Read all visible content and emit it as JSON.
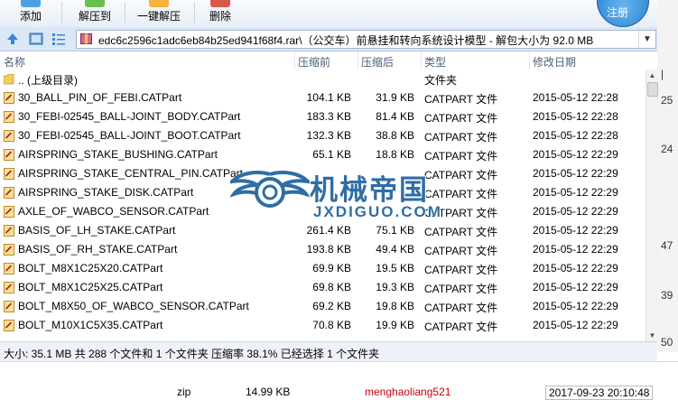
{
  "toolbar": {
    "buttons": [
      {
        "label": "添加",
        "icon": "add-icon"
      },
      {
        "label": "解压到",
        "icon": "extract-to-icon"
      },
      {
        "label": "一键解压",
        "icon": "one-click-extract-icon"
      },
      {
        "label": "删除",
        "icon": "delete-icon"
      }
    ],
    "logo_text": "注册"
  },
  "address": {
    "path": "edc6c2596c1adc6eb84b25ed941f68f4.rar\\（公交车）前悬挂和转向系统设计模型 - 解包大小为 92.0 MB"
  },
  "columns": {
    "name": "名称",
    "size": "压缩前",
    "packed": "压缩后",
    "type": "类型",
    "modified": "修改日期"
  },
  "files": [
    {
      "name": ".. (上级目录)",
      "size": "",
      "packed": "",
      "type": "文件夹",
      "date": "",
      "icon": "folder-icon"
    },
    {
      "name": "30_BALL_PIN_OF_FEBI.CATPart",
      "size": "104.1 KB",
      "packed": "31.9 KB",
      "type": "CATPART 文件",
      "date": "2015-05-12 22:28",
      "icon": "catpart-file-icon"
    },
    {
      "name": "30_FEBI-02545_BALL-JOINT_BODY.CATPart",
      "size": "183.3 KB",
      "packed": "81.4 KB",
      "type": "CATPART 文件",
      "date": "2015-05-12 22:28",
      "icon": "catpart-file-icon"
    },
    {
      "name": "30_FEBI-02545_BALL-JOINT_BOOT.CATPart",
      "size": "132.3 KB",
      "packed": "38.8 KB",
      "type": "CATPART 文件",
      "date": "2015-05-12 22:28",
      "icon": "catpart-file-icon"
    },
    {
      "name": "AIRSPRING_STAKE_BUSHING.CATPart",
      "size": "65.1 KB",
      "packed": "18.8 KB",
      "type": "CATPART 文件",
      "date": "2015-05-12 22:29",
      "icon": "catpart-file-icon"
    },
    {
      "name": "AIRSPRING_STAKE_CENTRAL_PIN.CATPart",
      "size": "",
      "packed": "",
      "type": "CATPART 文件",
      "date": "2015-05-12 22:29",
      "icon": "catpart-file-icon"
    },
    {
      "name": "AIRSPRING_STAKE_DISK.CATPart",
      "size": "",
      "packed": "",
      "type": "CATPART 文件",
      "date": "2015-05-12 22:29",
      "icon": "catpart-file-icon"
    },
    {
      "name": "AXLE_OF_WABCO_SENSOR.CATPart",
      "size": "",
      "packed": "",
      "type": "CATPART 文件",
      "date": "2015-05-12 22:29",
      "icon": "catpart-file-icon"
    },
    {
      "name": "BASIS_OF_LH_STAKE.CATPart",
      "size": "261.4 KB",
      "packed": "75.1 KB",
      "type": "CATPART 文件",
      "date": "2015-05-12 22:29",
      "icon": "catpart-file-icon"
    },
    {
      "name": "BASIS_OF_RH_STAKE.CATPart",
      "size": "193.8 KB",
      "packed": "49.4 KB",
      "type": "CATPART 文件",
      "date": "2015-05-12 22:29",
      "icon": "catpart-file-icon"
    },
    {
      "name": "BOLT_M8X1C25X20.CATPart",
      "size": "69.9 KB",
      "packed": "19.5 KB",
      "type": "CATPART 文件",
      "date": "2015-05-12 22:29",
      "icon": "catpart-file-icon"
    },
    {
      "name": "BOLT_M8X1C25X25.CATPart",
      "size": "69.8 KB",
      "packed": "19.3 KB",
      "type": "CATPART 文件",
      "date": "2015-05-12 22:29",
      "icon": "catpart-file-icon"
    },
    {
      "name": "BOLT_M8X50_OF_WABCO_SENSOR.CATPart",
      "size": "69.2 KB",
      "packed": "19.8 KB",
      "type": "CATPART 文件",
      "date": "2015-05-12 22:29",
      "icon": "catpart-file-icon"
    },
    {
      "name": "BOLT_M10X1C5X35.CATPart",
      "size": "70.8 KB",
      "packed": "19.9 KB",
      "type": "CATPART 文件",
      "date": "2015-05-12 22:29",
      "icon": "catpart-file-icon"
    }
  ],
  "status": {
    "text": "大小: 35.1 MB 共 288 个文件和 1 个文件夹 压缩率 38.1% 已经选择 1 个文件夹"
  },
  "watermark": {
    "title": "机械帝国",
    "url": "JXDIGUO.COM"
  },
  "background": {
    "right_edge": [
      "|",
      "25",
      "24",
      "47",
      "39",
      "50"
    ],
    "below_row": {
      "ext": "zip",
      "size": "14.99 KB",
      "user": "menghaoliang521",
      "date": "2017-09-23 20:10:48"
    }
  },
  "colors": {
    "toolbar_bg": "#e7eef7",
    "address_bg": "#dbe7f5",
    "watermark": "#2f6ea5",
    "link_red": "#c7000b"
  }
}
